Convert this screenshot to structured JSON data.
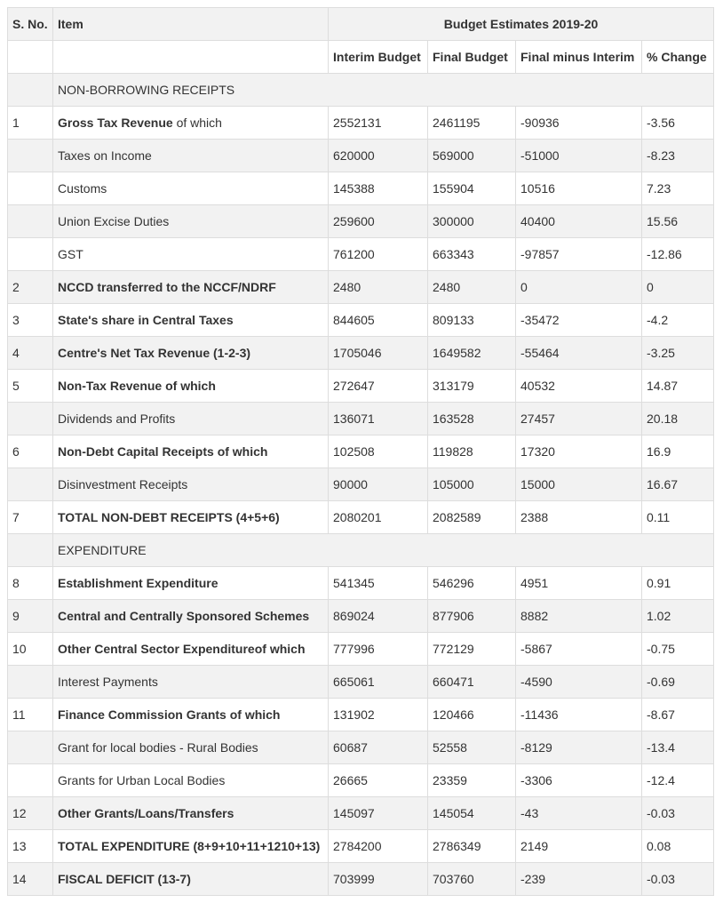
{
  "header": {
    "sno": "S. No.",
    "item": "Item",
    "group": "Budget Estimates 2019-20",
    "cols": [
      "Interim Budget",
      "Final Budget",
      "Final minus Interim",
      "% Change"
    ]
  },
  "rows": [
    {
      "type": "section",
      "label": "NON-BORROWING RECEIPTS"
    },
    {
      "type": "data",
      "sno": "1",
      "label": "Gross Tax Revenue",
      "suffix": " of which",
      "label_bold": true,
      "values_bold": true,
      "values": [
        "2552131",
        "2461195",
        "-90936",
        "-3.56"
      ]
    },
    {
      "type": "data",
      "sno": "",
      "label": "Taxes on Income",
      "suffix": "",
      "label_bold": false,
      "values_bold": false,
      "values": [
        "620000",
        "569000",
        "-51000",
        "-8.23"
      ]
    },
    {
      "type": "data",
      "sno": "",
      "label": "Customs",
      "suffix": "",
      "label_bold": false,
      "values_bold": false,
      "values": [
        "145388",
        "155904",
        "10516",
        "7.23"
      ]
    },
    {
      "type": "data",
      "sno": "",
      "label": "Union Excise Duties",
      "suffix": "",
      "label_bold": false,
      "values_bold": false,
      "values": [
        "259600",
        "300000",
        "40400",
        "15.56"
      ]
    },
    {
      "type": "data",
      "sno": "",
      "label": "GST",
      "suffix": "",
      "label_bold": false,
      "values_bold": false,
      "values": [
        "761200",
        "663343",
        "-97857",
        "-12.86"
      ]
    },
    {
      "type": "data",
      "sno": "2",
      "label": "NCCD transferred to the NCCF/NDRF",
      "suffix": "",
      "label_bold": true,
      "values_bold": false,
      "values": [
        "2480",
        "2480",
        "0",
        "0"
      ]
    },
    {
      "type": "data",
      "sno": "3",
      "label": "State's share in Central Taxes",
      "suffix": "",
      "label_bold": true,
      "values_bold": false,
      "values": [
        "844605",
        "809133",
        "-35472",
        "-4.2"
      ]
    },
    {
      "type": "data",
      "sno": "4",
      "label": "Centre's Net Tax Revenue (1-2-3)",
      "suffix": "",
      "label_bold": true,
      "values_bold": false,
      "values": [
        "1705046",
        "1649582",
        "-55464",
        "-3.25"
      ]
    },
    {
      "type": "data",
      "sno": "5",
      "label": "Non-Tax Revenue of which",
      "suffix": "",
      "label_bold": true,
      "values_bold": false,
      "values": [
        "272647",
        "313179",
        "40532",
        "14.87"
      ]
    },
    {
      "type": "data",
      "sno": "",
      "label": "Dividends and Profits",
      "suffix": "",
      "label_bold": false,
      "values_bold": false,
      "values": [
        "136071",
        "163528",
        "27457",
        "20.18"
      ]
    },
    {
      "type": "data",
      "sno": "6",
      "label": "Non-Debt Capital Receipts of which",
      "suffix": "",
      "label_bold": true,
      "values_bold": false,
      "values": [
        "102508",
        "119828",
        "17320",
        "16.9"
      ]
    },
    {
      "type": "data",
      "sno": "",
      "label": "Disinvestment Receipts",
      "suffix": "",
      "label_bold": false,
      "values_bold": false,
      "values": [
        "90000",
        "105000",
        "15000",
        "16.67"
      ]
    },
    {
      "type": "data",
      "sno": "7",
      "label": "TOTAL NON-DEBT RECEIPTS (4+5+6)",
      "suffix": "",
      "label_bold": true,
      "values_bold": false,
      "values": [
        "2080201",
        "2082589",
        "2388",
        "0.11"
      ]
    },
    {
      "type": "section",
      "label": "EXPENDITURE"
    },
    {
      "type": "data",
      "sno": "8",
      "label": "Establishment Expenditure",
      "suffix": "",
      "label_bold": true,
      "values_bold": false,
      "values": [
        "541345",
        "546296",
        "4951",
        "0.91"
      ]
    },
    {
      "type": "data",
      "sno": "9",
      "label": "Central and Centrally Sponsored Schemes",
      "suffix": "",
      "label_bold": true,
      "values_bold": false,
      "values": [
        "869024",
        "877906",
        "8882",
        "1.02"
      ]
    },
    {
      "type": "data",
      "sno": "10",
      "label": "Other Central Sector Expenditureof which",
      "suffix": "",
      "label_bold": true,
      "values_bold": false,
      "values": [
        "777996",
        "772129",
        "-5867",
        "-0.75"
      ]
    },
    {
      "type": "data",
      "sno": "",
      "label": "Interest Payments",
      "suffix": "",
      "label_bold": false,
      "values_bold": false,
      "values": [
        "665061",
        "660471",
        "-4590",
        "-0.69"
      ]
    },
    {
      "type": "data",
      "sno": "11",
      "label": "Finance Commission Grants of which",
      "suffix": "",
      "label_bold": true,
      "values_bold": false,
      "values": [
        "131902",
        "120466",
        "-11436",
        "-8.67"
      ]
    },
    {
      "type": "data",
      "sno": "",
      "label": "Grant for local bodies - Rural Bodies",
      "suffix": "",
      "label_bold": false,
      "values_bold": false,
      "values": [
        "60687",
        "52558",
        "-8129",
        "-13.4"
      ]
    },
    {
      "type": "data",
      "sno": "",
      "label": "Grants for Urban Local Bodies",
      "suffix": "",
      "label_bold": false,
      "values_bold": false,
      "values": [
        "26665",
        "23359",
        "-3306",
        "-12.4"
      ]
    },
    {
      "type": "data",
      "sno": "12",
      "label": "Other Grants/Loans/Transfers",
      "suffix": "",
      "label_bold": true,
      "values_bold": false,
      "values": [
        "145097",
        "145054",
        "-43",
        "-0.03"
      ]
    },
    {
      "type": "data",
      "sno": "13",
      "label": "TOTAL EXPENDITURE (8+9+10+11+1210+13)",
      "suffix": "",
      "label_bold": true,
      "values_bold": false,
      "values": [
        "2784200",
        "2786349",
        "2149",
        "0.08"
      ]
    },
    {
      "type": "data",
      "sno": "14",
      "label": "FISCAL DEFICIT (13-7)",
      "suffix": "",
      "label_bold": true,
      "values_bold": false,
      "values": [
        "703999",
        "703760",
        "-239",
        "-0.03"
      ]
    }
  ],
  "colors": {
    "border": "#dddddd",
    "stripe": "#f2f2f2",
    "text": "#333333"
  }
}
